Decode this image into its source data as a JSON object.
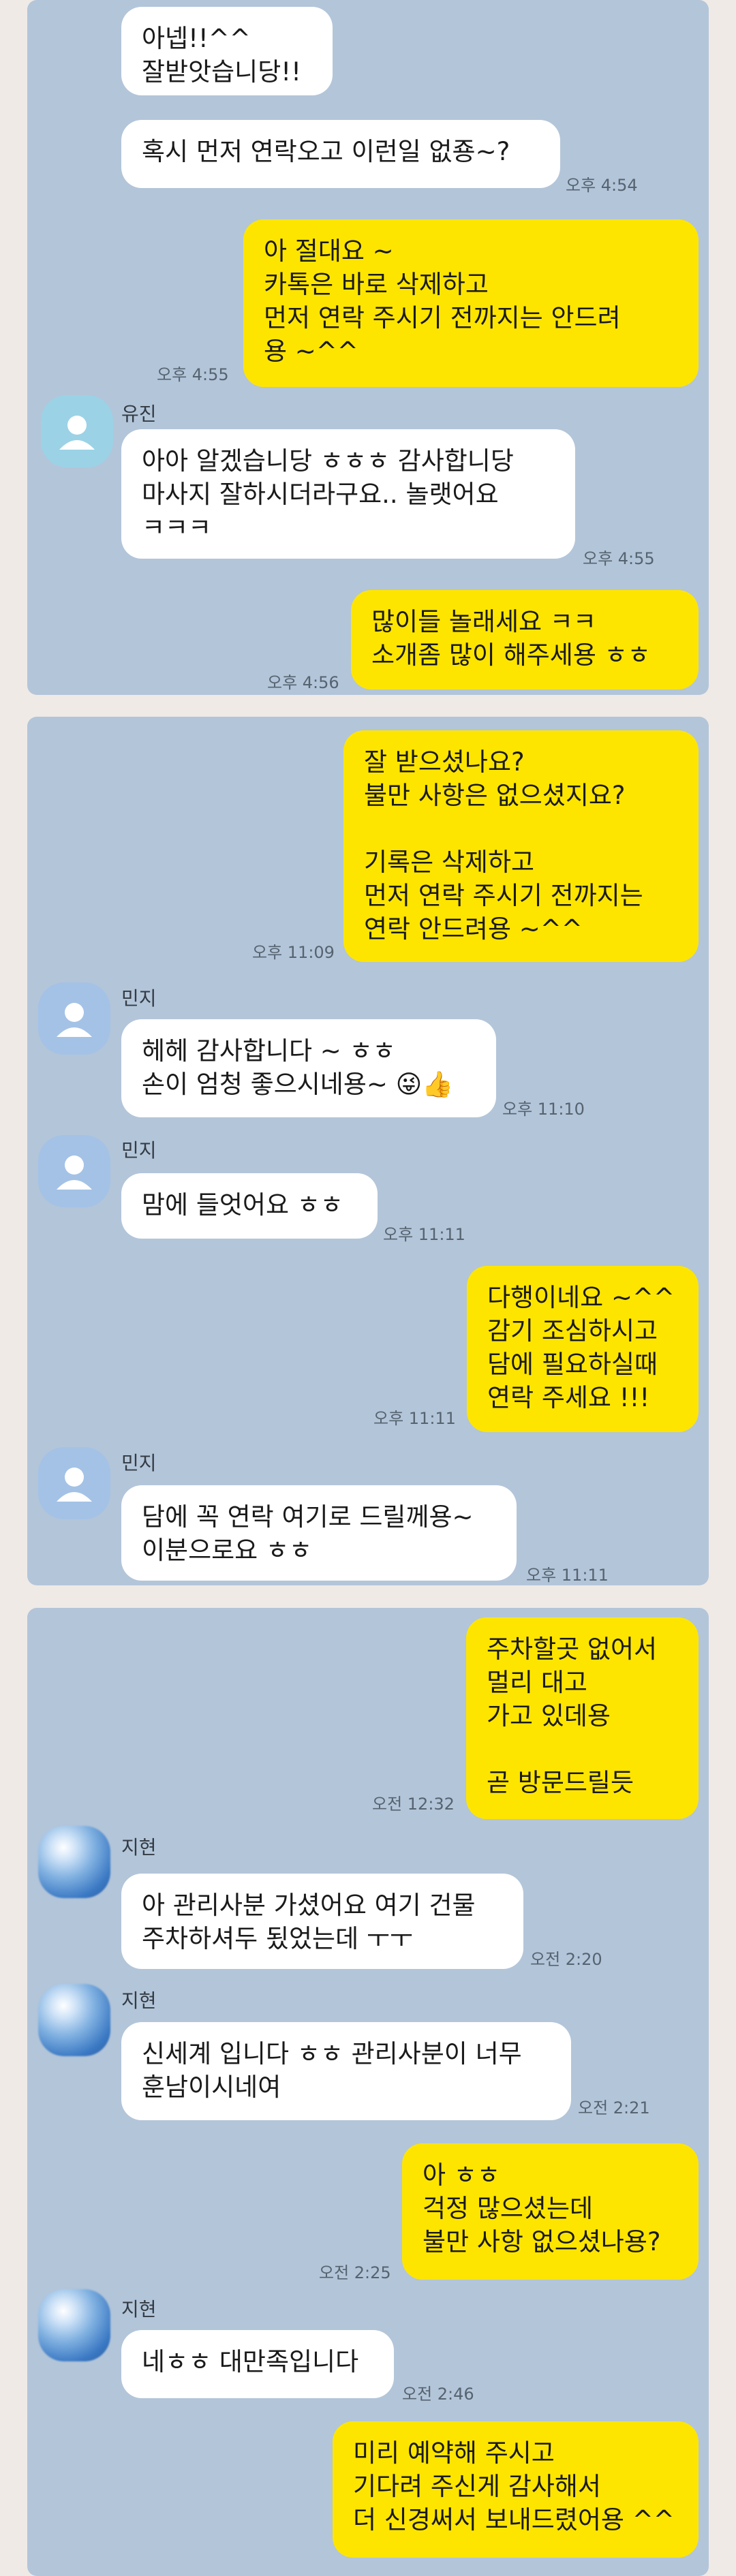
{
  "panel1": {
    "messages": [
      {
        "text": "아넵!!^^\n잘받앗습니당!!"
      },
      {
        "text": "혹시 먼저 연락오고 이런일 없죵~?",
        "time": "오후 4:54"
      },
      {
        "text": "아 절대요 ~\n카톡은 바로 삭제하고\n먼저 연락 주시기 전까지는 안드려\n용 ~^^",
        "time": "오후 4:55"
      },
      {
        "sender": "유진",
        "text": "아아 알겠습니당 ㅎㅎㅎ 감사합니당\n마사지 잘하시더라구요.. 놀랫어요\nㅋㅋㅋ",
        "time": "오후 4:55"
      },
      {
        "text": "많이들 놀래세요 ㅋㅋ\n소개좀 많이 해주세용 ㅎㅎ",
        "time": "오후 4:56"
      }
    ]
  },
  "panel2": {
    "messages": [
      {
        "text": "잘 받으셨나요?\n불만 사항은 없으셨지요?\n\n기록은 삭제하고\n먼저 연락 주시기 전까지는\n연락 안드려용 ~^^",
        "time": "오후 11:09"
      },
      {
        "sender": "민지",
        "text": "헤헤 감사합니다 ~ ㅎㅎ\n손이 엄청 좋으시네용~ 😜👍",
        "time": "오후 11:10"
      },
      {
        "sender": "민지",
        "text": "맘에 들엇어요 ㅎㅎ",
        "time": "오후 11:11"
      },
      {
        "text": "다행이네요 ~^^\n감기 조심하시고\n담에 필요하실때\n연락 주세요 !!!",
        "time": "오후 11:11"
      },
      {
        "sender": "민지",
        "text": "담에 꼭 연락 여기로 드릴께용~\n이분으로요 ㅎㅎ",
        "time": "오후 11:11"
      }
    ]
  },
  "panel3": {
    "messages": [
      {
        "text": "주차할곳 없어서\n멀리 대고\n가고 있데용\n\n곧 방문드릴듯",
        "time": "오전 12:32"
      },
      {
        "sender": "지현",
        "text": "아 관리사분 가셨어요 여기 건물\n주차하셔두 됬었는데 ㅜㅜ",
        "time": "오전 2:20"
      },
      {
        "sender": "지현",
        "text": "신세계 입니다 ㅎㅎ 관리사분이 너무\n훈남이시네여",
        "time": "오전 2:21"
      },
      {
        "text": "아 ㅎㅎ\n걱정 많으셨는데\n불만 사항 없으셨나용?",
        "time": "오전 2:25"
      },
      {
        "sender": "지현",
        "text": "네ㅎㅎ 대만족입니다",
        "time": "오전 2:46"
      },
      {
        "text": "미리 예약해 주시고\n기다려 주신게 감사해서\n더 신경써서 보내드렸어용 ^^"
      }
    ]
  },
  "colors": {
    "chat_background": "#b3c5d9",
    "outgoing_bubble": "#fee500",
    "incoming_bubble": "#ffffff",
    "page_background": "#efeae6"
  }
}
